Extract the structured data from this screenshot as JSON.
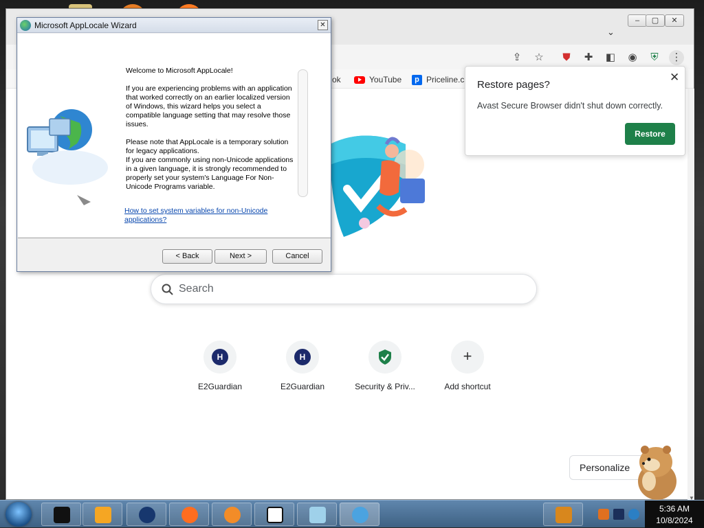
{
  "browser": {
    "bookmarks": [
      {
        "label": "ok",
        "icon": "bookmark-icon"
      },
      {
        "label": "YouTube",
        "icon": "youtube-icon"
      },
      {
        "label": "Priceline.c",
        "icon": "priceline-icon"
      }
    ]
  },
  "new_tab": {
    "search_placeholder": "Search",
    "shortcuts": [
      {
        "label": "E2Guardian",
        "icon": "H"
      },
      {
        "label": "E2Guardian",
        "icon": "H"
      },
      {
        "label": "Security & Priv...",
        "icon": "shield-check-icon"
      },
      {
        "label": "Add shortcut",
        "icon": "+"
      }
    ],
    "personalize_label": "Personalize"
  },
  "restore_popup": {
    "title": "Restore pages?",
    "message": "Avast Secure Browser didn't shut down correctly.",
    "button": "Restore",
    "accent": "#1e8049"
  },
  "dialog": {
    "title": "Microsoft AppLocale Wizard",
    "welcome": "Welcome to Microsoft AppLocale!",
    "paragraph1": "If you are experiencing problems with an application that worked correctly on an earlier localized version of Windows, this wizard helps you select a compatible language setting that may resolve those issues.",
    "paragraph2": "Please note that AppLocale is a temporary solution for legacy applications.",
    "paragraph3": "If you are commonly using non-Unicode applications in a given language, it is strongly recommended to properly set your system's Language For Non-Unicode Programs variable.",
    "link": "How to set system variables for non-Unicode applications?",
    "back_button": "< Back",
    "next_button": "Next >",
    "cancel_button": "Cancel"
  },
  "taskbar": {
    "time": "5:36 AM",
    "date": "10/8/2024",
    "apps": [
      "terminal-icon",
      "media-player-icon",
      "globe-app-icon",
      "firefox-icon",
      "avast-browser-icon",
      "7zip-icon",
      "notepad-icon",
      "applocale-icon"
    ]
  },
  "colors": {
    "dialog_link": "#0645ad",
    "taskbar": "#4b6f93"
  }
}
